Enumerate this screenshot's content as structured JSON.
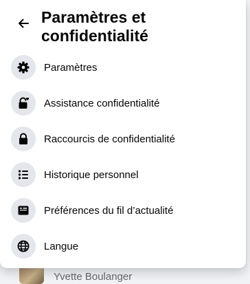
{
  "header": {
    "title": "Paramètres et confidentialité"
  },
  "menu": {
    "items": [
      {
        "label": "Paramètres",
        "icon": "gear-icon"
      },
      {
        "label": "Assistance confidentialité",
        "icon": "lock-heart-icon"
      },
      {
        "label": "Raccourcis de confidentialité",
        "icon": "lock-icon"
      },
      {
        "label": "Historique personnel",
        "icon": "list-icon"
      },
      {
        "label": "Préférences du fil d’actualité",
        "icon": "feed-icon"
      },
      {
        "label": "Langue",
        "icon": "globe-icon"
      }
    ]
  },
  "background": {
    "peek_name": "Yvette Boulanger"
  },
  "colors": {
    "text": "#050505",
    "icon_bg": "#e4e6eb",
    "panel_bg": "#ffffff"
  }
}
